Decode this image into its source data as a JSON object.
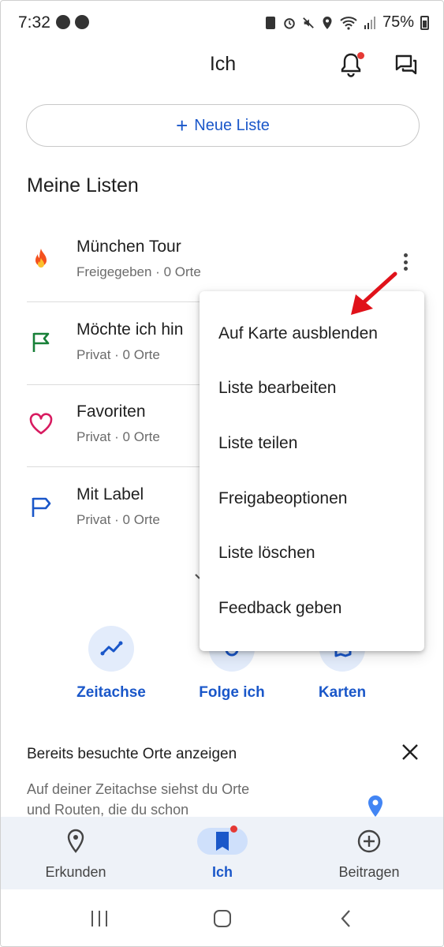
{
  "status_bar": {
    "time": "7:32",
    "battery": "75%"
  },
  "header": {
    "title": "Ich"
  },
  "new_list": {
    "plus": "+",
    "label": "Neue Liste"
  },
  "my_lists": {
    "title": "Meine Listen",
    "items": [
      {
        "title": "München Tour",
        "subtitle": "Freigegeben · 0 Orte",
        "icon": "fire-icon"
      },
      {
        "title": "Möchte ich hin",
        "subtitle": "Privat · 0 Orte",
        "icon": "flag-icon",
        "color": "#188038"
      },
      {
        "title": "Favoriten",
        "subtitle": "Privat · 0 Orte",
        "icon": "heart-icon",
        "color": "#d81b60"
      },
      {
        "title": "Mit Label",
        "subtitle": "Privat · 0 Orte",
        "icon": "label-flag-icon",
        "color": "#1a57c9"
      }
    ]
  },
  "context_menu": {
    "items": [
      "Auf Karte ausblenden",
      "Liste bearbeiten",
      "Liste teilen",
      "Freigabeoptionen",
      "Liste löschen",
      "Feedback geben"
    ]
  },
  "actions": [
    {
      "label": "Zeitachse",
      "icon": "timeline-icon"
    },
    {
      "label": "Folge ich",
      "icon": "following-icon"
    },
    {
      "label": "Karten",
      "icon": "maps-icon"
    }
  ],
  "visited": {
    "title": "Bereits besuchte Orte anzeigen",
    "body": "Auf deiner Zeitachse siehst du Orte und Routen, die du schon"
  },
  "bottom_nav": [
    {
      "label": "Erkunden",
      "icon": "location-pin-icon"
    },
    {
      "label": "Ich",
      "icon": "bookmark-icon",
      "active": true
    },
    {
      "label": "Beitragen",
      "icon": "add-circle-icon"
    }
  ],
  "colors": {
    "accent": "#1a57c9",
    "notification": "#e53935",
    "annotation_arrow": "#e0121a"
  }
}
